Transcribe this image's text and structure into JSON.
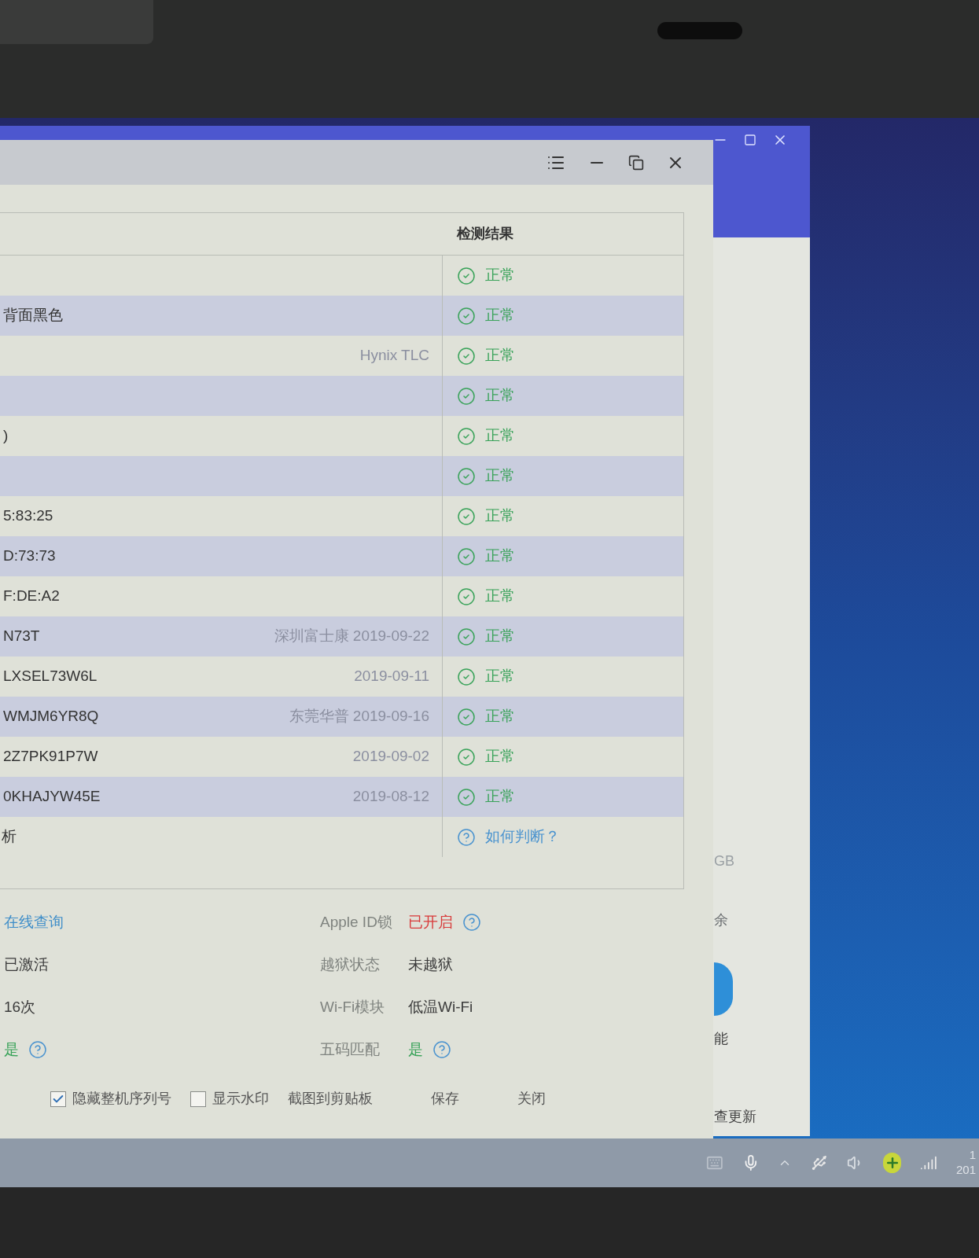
{
  "background_window": {
    "texts": [
      "GB",
      "余",
      "能",
      "查更新"
    ]
  },
  "dialog": {
    "result_header": "检测结果",
    "rows": [
      {
        "value": "",
        "extra": "",
        "result": "正常"
      },
      {
        "value": "背面黑色",
        "extra": "",
        "result": "正常"
      },
      {
        "value": "",
        "extra": "Hynix TLC",
        "result": "正常"
      },
      {
        "value": "",
        "extra": "",
        "result": "正常"
      },
      {
        "value": ")",
        "extra": "",
        "result": "正常"
      },
      {
        "value": "",
        "extra": "",
        "result": "正常"
      },
      {
        "value": "5:83:25",
        "extra": "",
        "result": "正常"
      },
      {
        "value": "D:73:73",
        "extra": "",
        "result": "正常"
      },
      {
        "value": "F:DE:A2",
        "extra": "",
        "result": "正常"
      },
      {
        "value": "N73T",
        "extra": "深圳富士康 2019-09-22",
        "result": "正常"
      },
      {
        "value": "LXSEL73W6L",
        "extra": "2019-09-11",
        "result": "正常"
      },
      {
        "value": "WMJM6YR8Q",
        "extra": "东莞华普 2019-09-16",
        "result": "正常"
      },
      {
        "value": "2Z7PK91P7W",
        "extra": "2019-09-02",
        "result": "正常"
      },
      {
        "value": "0KHAJYW45E",
        "extra": "2019-08-12",
        "result": "正常"
      }
    ],
    "last_row": {
      "value": "析",
      "help_link": "如何判断？"
    },
    "info_left": [
      {
        "value": "在线查询",
        "kind": "link",
        "help": false
      },
      {
        "value": "已激活",
        "kind": "plain",
        "help": false
      },
      {
        "value": "16次",
        "kind": "plain",
        "help": false
      },
      {
        "value": "是",
        "kind": "good",
        "help": true
      }
    ],
    "info_right": [
      {
        "label": "Apple ID锁",
        "value": "已开启",
        "kind": "alert",
        "help": true
      },
      {
        "label": "越狱状态",
        "value": "未越狱",
        "kind": "plain",
        "help": false
      },
      {
        "label": "Wi-Fi模块",
        "value": "低温Wi-Fi",
        "kind": "plain",
        "help": false
      },
      {
        "label": "五码匹配",
        "value": "是",
        "kind": "good",
        "help": true
      }
    ],
    "footer": {
      "checkboxes": [
        {
          "label": "隐藏整机序列号",
          "checked": true
        },
        {
          "label": "显示水印",
          "checked": false
        }
      ],
      "buttons": [
        "截图到剪贴板",
        "保存",
        "关闭"
      ]
    }
  },
  "taskbar": {
    "clock": [
      "1",
      "201"
    ]
  }
}
